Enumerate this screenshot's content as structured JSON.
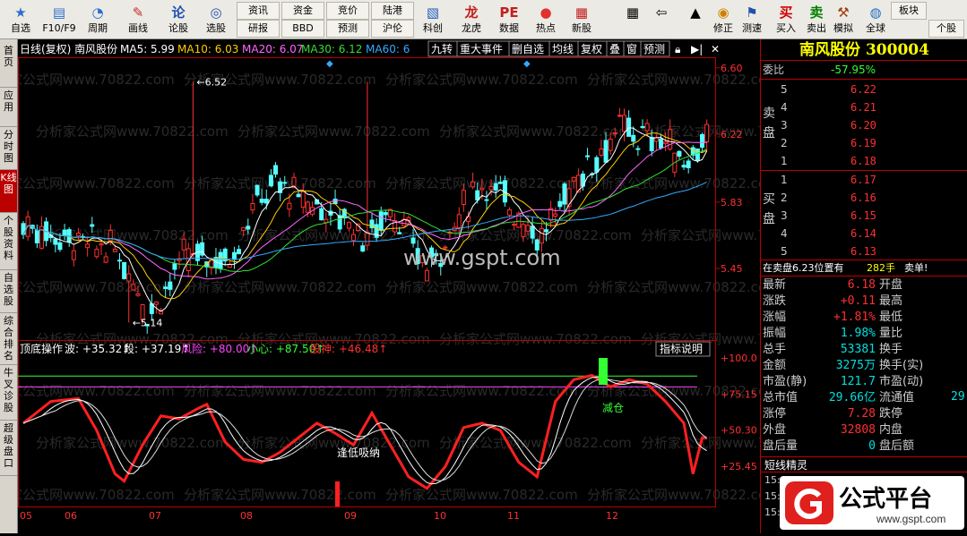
{
  "toolbar": {
    "buttons": [
      {
        "label": "自选",
        "icon": "star-icon"
      },
      {
        "label": "F10/F9",
        "icon": "document-icon"
      },
      {
        "label": "周期",
        "icon": "clock-icon"
      },
      {
        "label": "画线",
        "icon": "pencil-icon"
      },
      {
        "label": "论股",
        "icon": "bbs-icon"
      },
      {
        "label": "选股",
        "icon": "chart-search-icon"
      },
      {
        "label": "科创",
        "icon": "kechuang-icon"
      },
      {
        "label": "龙虎",
        "icon": "dragon-icon"
      },
      {
        "label": "数据",
        "icon": "pe-icon"
      },
      {
        "label": "热点",
        "icon": "hot-icon"
      },
      {
        "label": "新股",
        "icon": "new-stock-icon"
      },
      {
        "label": "修正",
        "icon": "fix-icon"
      },
      {
        "label": "测速",
        "icon": "speed-icon"
      },
      {
        "label": "买入",
        "icon": "buy-icon"
      },
      {
        "label": "卖出",
        "icon": "sell-icon"
      },
      {
        "label": "模拟",
        "icon": "hammer-icon"
      },
      {
        "label": "全球",
        "icon": "globe-icon"
      }
    ],
    "small_buttons": [
      "资讯",
      "资金",
      "竞价",
      "陆港",
      "研报",
      "BBD",
      "预测",
      "沪伦",
      "板块",
      "个股"
    ]
  },
  "left_nav": [
    "首页",
    "应用",
    "分时图",
    "K线图",
    "个股资料",
    "自选股",
    "综合排名",
    "牛叉诊股",
    "超级盘口"
  ],
  "chart_header": {
    "title": "日线(复权) 南风股份",
    "ma5": "MA5: 5.99",
    "ma10": "MA10: 6.03",
    "ma20": "MA20: 6.07",
    "ma30": "MA30: 6.12",
    "ma60": "MA60: 6",
    "tabs": [
      "九转",
      "重大事件",
      "删自选",
      "均线",
      "复权",
      "叠",
      "窗",
      "预测"
    ],
    "watermark": "www.gspt.com",
    "bg_watermark": "分析家公式网www.70822.com",
    "price_ticks": [
      "6.60",
      "6.22",
      "5.83",
      "5.45"
    ],
    "high_label": "6.52",
    "low_label": "5.14"
  },
  "indicator": {
    "name": "顶底操作",
    "wave": "波: +35.32",
    "duan": "段: +37.19",
    "risk": "风险: +80.00",
    "care": "小心: +87.50",
    "poison": "股神: +46.48",
    "help": "指标说明",
    "ticks": [
      "+100.0",
      "+75.15",
      "+50.30",
      "+25.45"
    ],
    "sell_label": "减仓",
    "buy_label": "逢低吸纳"
  },
  "months": [
    "05",
    "06",
    "07",
    "08",
    "09",
    "10",
    "11",
    "12"
  ],
  "quote": {
    "name": "南风股份",
    "code": "300004",
    "weibi_label": "委比",
    "weibi": "-57.95%",
    "sell_label": "卖盘",
    "buy_label": "买盘",
    "sells": [
      {
        "n": "5",
        "p": "6.22"
      },
      {
        "n": "4",
        "p": "6.21"
      },
      {
        "n": "3",
        "p": "6.20"
      },
      {
        "n": "2",
        "p": "6.19"
      },
      {
        "n": "1",
        "p": "6.18"
      }
    ],
    "buys": [
      {
        "n": "1",
        "p": "6.17"
      },
      {
        "n": "2",
        "p": "6.16"
      },
      {
        "n": "3",
        "p": "6.15"
      },
      {
        "n": "4",
        "p": "6.14"
      },
      {
        "n": "5",
        "p": "6.13"
      }
    ],
    "msg": "在卖盘6.23位置有",
    "msg_val": "282手",
    "msg2": "卖单!",
    "stats": [
      {
        "l": "最新",
        "v": "6.18",
        "r": "开盘",
        "c": "#ff3030"
      },
      {
        "l": "涨跌",
        "v": "+0.11",
        "r": "最高",
        "c": "#ff3030"
      },
      {
        "l": "涨幅",
        "v": "+1.81%",
        "r": "最低",
        "c": "#ff3030"
      },
      {
        "l": "振幅",
        "v": "1.98%",
        "r": "量比",
        "c": "#00e0e0"
      },
      {
        "l": "总手",
        "v": "53381",
        "r": "换手",
        "c": "#00e0e0"
      },
      {
        "l": "金额",
        "v": "3275万",
        "r": "换手(实)",
        "c": "#00e0e0"
      },
      {
        "l": "市盈(静)",
        "v": "121.7",
        "r": "市盈(动)",
        "c": "#00e0e0"
      },
      {
        "l": "总市值",
        "v": "29.66亿",
        "r": "流通值",
        "c": "#00e0e0"
      },
      {
        "l": "涨停",
        "v": "7.28",
        "r": "跌停",
        "c": "#ff3030"
      },
      {
        "l": "外盘",
        "v": "32808",
        "r": "内盘",
        "c": "#ff3030"
      },
      {
        "l": "盘后量",
        "v": "0",
        "r": "盘后额",
        "c": "#00e0e0"
      }
    ],
    "extra": "29",
    "short_title": "短线精灵",
    "short_rows": [
      "15:",
      "15:",
      "15:"
    ]
  },
  "logo": {
    "text": "公式平台",
    "url": "www.gspt.com"
  }
}
